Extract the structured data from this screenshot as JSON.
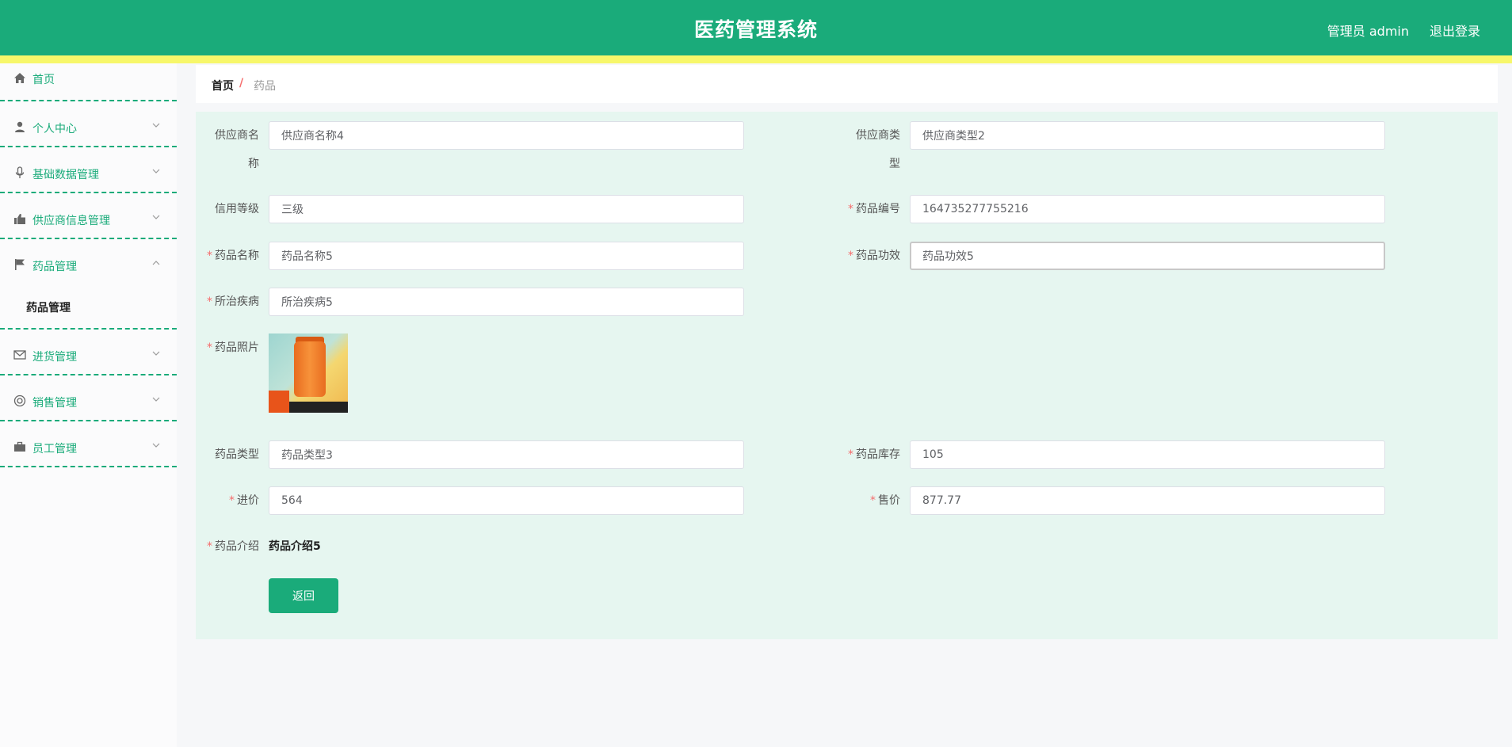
{
  "header": {
    "title": "医药管理系统",
    "user": "管理员 admin",
    "logout": "退出登录"
  },
  "sidebar": {
    "items": [
      {
        "label": "首页",
        "icon": "home-icon"
      },
      {
        "label": "个人中心",
        "icon": "user-icon"
      },
      {
        "label": "基础数据管理",
        "icon": "microphone-icon"
      },
      {
        "label": "供应商信息管理",
        "icon": "thumb-up-icon"
      },
      {
        "label": "药品管理",
        "icon": "flag-icon"
      },
      {
        "label": "进货管理",
        "icon": "mail-icon"
      },
      {
        "label": "销售管理",
        "icon": "lifebuoy-icon"
      },
      {
        "label": "员工管理",
        "icon": "briefcase-icon"
      }
    ],
    "submenu_label": "药品管理"
  },
  "breadcrumb": {
    "home": "首页",
    "separator": "/",
    "current": "药品"
  },
  "form": {
    "supplier_name": {
      "label_line1": "供应商名",
      "label_line2": "称",
      "value": "供应商名称4"
    },
    "supplier_type": {
      "label_line1": "供应商类",
      "label_line2": "型",
      "value": "供应商类型2"
    },
    "credit_level": {
      "label": "信用等级",
      "value": "三级"
    },
    "drug_code": {
      "label": "药品编号",
      "value": "164735277755216"
    },
    "drug_name": {
      "label": "药品名称",
      "value": "药品名称5"
    },
    "drug_effect": {
      "label": "药品功效",
      "value": "药品功效5"
    },
    "disease": {
      "label": "所治疾病",
      "value": "所治疾病5"
    },
    "photo": {
      "label": "药品照片"
    },
    "drug_type": {
      "label": "药品类型",
      "value": "药品类型3"
    },
    "stock": {
      "label": "药品库存",
      "value": "105"
    },
    "purchase_price": {
      "label": "进价",
      "value": "564"
    },
    "sale_price": {
      "label": "售价",
      "value": "877.77"
    },
    "intro": {
      "label": "药品介绍",
      "value": "药品介绍5"
    },
    "required_mark": "*",
    "back_button": "返回"
  },
  "colors": {
    "primary": "#1aab7a",
    "header_stripe": "#f7f76a",
    "form_bg": "#e6f6f0",
    "required": "#f56c6c"
  }
}
